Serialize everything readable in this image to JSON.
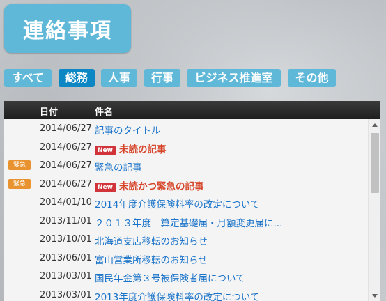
{
  "page_title": "連絡事項",
  "tabs": [
    {
      "label": "すべて",
      "active": false
    },
    {
      "label": "総務",
      "active": true
    },
    {
      "label": "人事",
      "active": false
    },
    {
      "label": "行事",
      "active": false
    },
    {
      "label": "ビジネス推進室",
      "active": false
    },
    {
      "label": "その他",
      "active": false
    }
  ],
  "table": {
    "headers": {
      "date": "日付",
      "subject": "件名"
    },
    "badges": {
      "new": "New",
      "urgent": "緊急"
    },
    "rows": [
      {
        "urgent": false,
        "date": "2014/06/27",
        "is_new": false,
        "subject": "記事のタイトル"
      },
      {
        "urgent": false,
        "date": "2014/06/27",
        "is_new": true,
        "subject": "未読の記事"
      },
      {
        "urgent": true,
        "date": "2014/06/27",
        "is_new": false,
        "subject": "緊急の記事"
      },
      {
        "urgent": true,
        "date": "2014/06/27",
        "is_new": true,
        "subject": "未読かつ緊急の記事"
      },
      {
        "urgent": false,
        "date": "2014/01/10",
        "is_new": false,
        "subject": "2014年度介護保険料率の改定について"
      },
      {
        "urgent": false,
        "date": "2013/11/01",
        "is_new": false,
        "subject": "２０１３年度　算定基礎届・月額変更届に..."
      },
      {
        "urgent": false,
        "date": "2013/10/01",
        "is_new": false,
        "subject": "北海道支店移転のお知らせ"
      },
      {
        "urgent": false,
        "date": "2013/06/01",
        "is_new": false,
        "subject": "富山営業所移転のお知らせ"
      },
      {
        "urgent": false,
        "date": "2013/03/01",
        "is_new": false,
        "subject": "国民年金第３号被保険者届について"
      },
      {
        "urgent": false,
        "date": "2013/03/01",
        "is_new": false,
        "subject": "2013年度介護保険料率の改定について"
      }
    ]
  },
  "colors": {
    "tab": "#5fb8d8",
    "tab_active": "#0c87c4",
    "link": "#1a73c9",
    "unread": "#d6452a",
    "badge_new": "#d0343a",
    "badge_urgent": "#e8932f"
  },
  "icons": {
    "scroll_up": "triangle-up-icon",
    "scroll_down": "triangle-down-icon"
  }
}
